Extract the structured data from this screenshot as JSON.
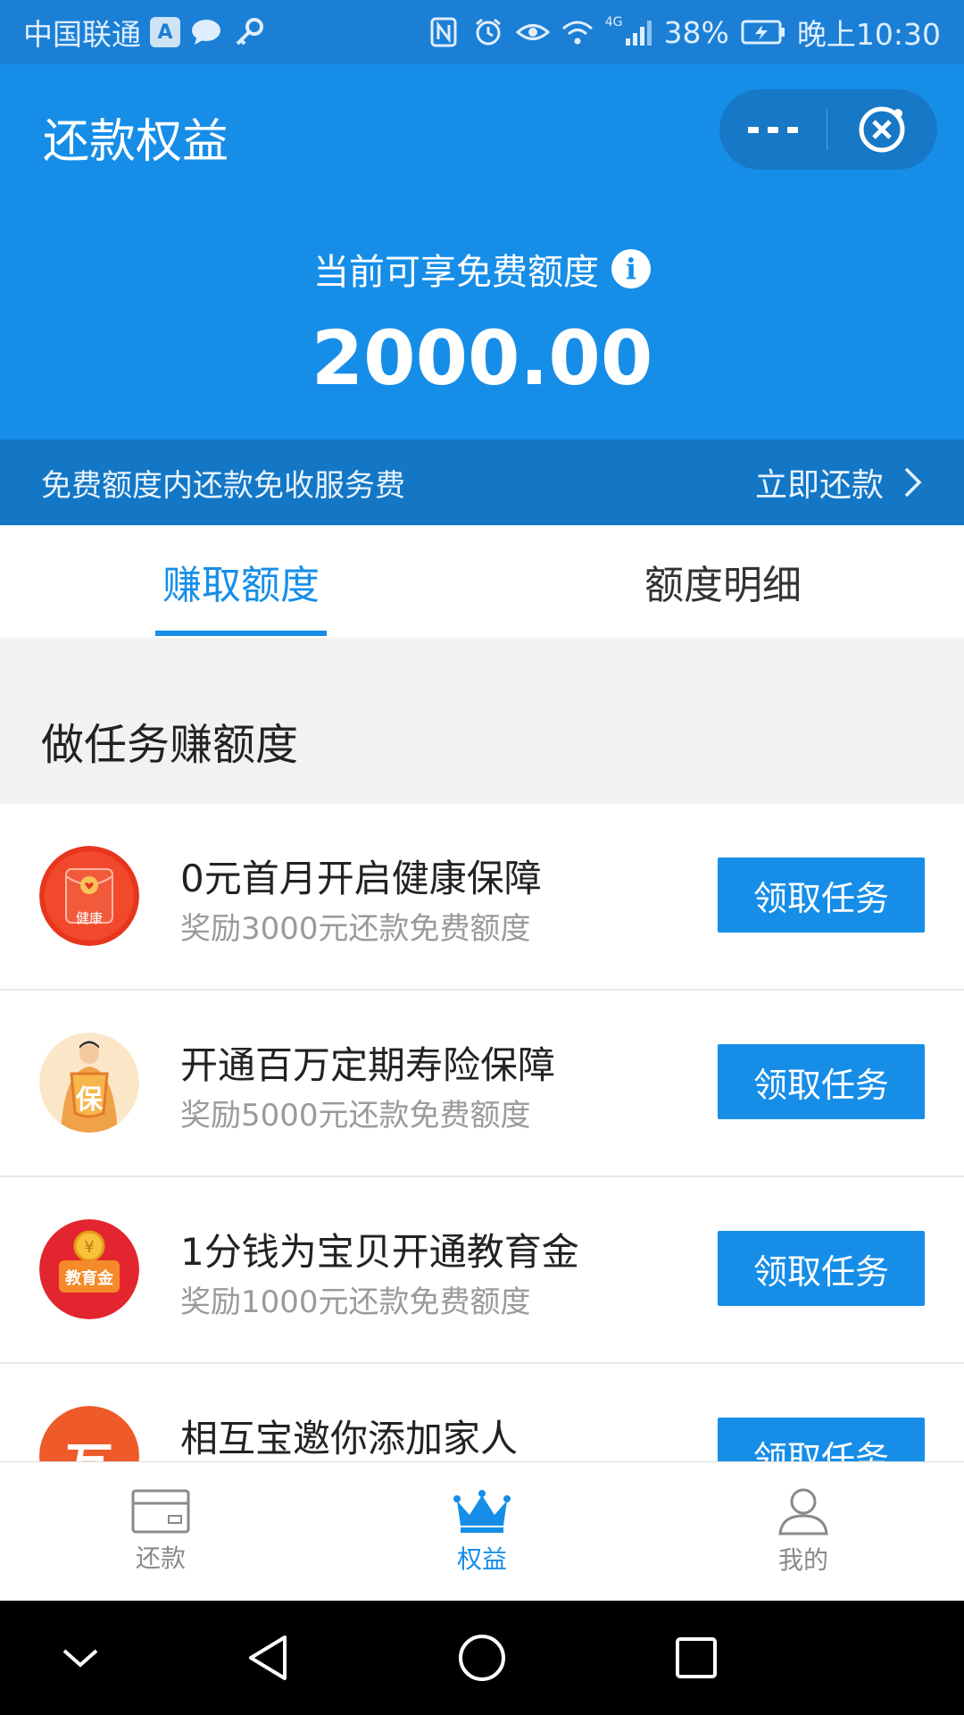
{
  "status_bar": {
    "carrier": "中国联通",
    "badge": "A",
    "network": "4G",
    "battery": "38%",
    "time": "晚上10:30"
  },
  "header": {
    "title": "还款权益",
    "quota_label": "当前可享免费额度",
    "info_glyph": "i",
    "quota_value": "2000.00",
    "notice_text": "免费额度内还款免收服务费",
    "notice_link": "立即还款"
  },
  "tabs": [
    {
      "label": "赚取额度",
      "active": true
    },
    {
      "label": "额度明细",
      "active": false
    }
  ],
  "section": {
    "title": "做任务赚额度"
  },
  "tasks": [
    {
      "title": "0元首月开启健康保障",
      "subtitle": "奖励3000元还款免费额度",
      "button": "领取任务",
      "icon_text": "健康",
      "icon": "red-envelope-icon"
    },
    {
      "title": "开通百万定期寿险保障",
      "subtitle": "奖励5000元还款免费额度",
      "button": "领取任务",
      "icon_text": "保",
      "icon": "insurance-person-icon"
    },
    {
      "title": "1分钱为宝贝开通教育金",
      "subtitle": "奖励1000元还款免费额度",
      "button": "领取任务",
      "icon_text": "教育金",
      "icon": "education-fund-icon"
    },
    {
      "title": "相互宝邀你添加家人",
      "subtitle": "",
      "button": "领取任务",
      "icon_text": "互",
      "icon": "xianghubao-icon"
    }
  ],
  "bottom_nav": [
    {
      "label": "还款",
      "icon": "card-icon",
      "active": false
    },
    {
      "label": "权益",
      "icon": "crown-icon",
      "active": true
    },
    {
      "label": "我的",
      "icon": "person-icon",
      "active": false
    }
  ],
  "colors": {
    "primary": "#168ee8",
    "header_dark": "#1377c6",
    "status_bar": "#1b7fd6",
    "background": "#f2f2f2"
  }
}
